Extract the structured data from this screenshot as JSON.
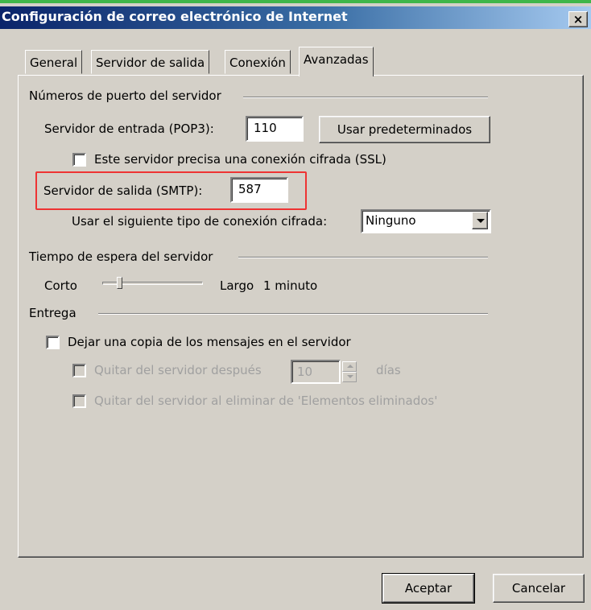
{
  "window": {
    "title": "Configuración de correo electrónico de Internet",
    "close_label": "×"
  },
  "tabs": [
    {
      "label": "General",
      "active": false
    },
    {
      "label": "Servidor de salida",
      "active": false
    },
    {
      "label": "Conexión",
      "active": false
    },
    {
      "label": "Avanzadas",
      "active": true
    }
  ],
  "ports": {
    "group_label": "Números de puerto del servidor",
    "incoming_label": "Servidor de entrada (POP3):",
    "incoming_value": "110",
    "defaults_button": "Usar predeterminados",
    "ssl_checkbox": {
      "label": "Este servidor precisa una conexión cifrada (SSL)",
      "checked": false
    },
    "outgoing_label": "Servidor de salida (SMTP):",
    "outgoing_value": "587",
    "encryption_label": "Usar el siguiente tipo de conexión cifrada:",
    "encryption_value": "Ninguno"
  },
  "timeout": {
    "group_label": "Tiempo de espera del servidor",
    "short_label": "Corto",
    "long_label": "Largo",
    "value_text": "1 minuto",
    "slider_level": 0.15
  },
  "delivery": {
    "group_label": "Entrega",
    "leave_copy": {
      "label": "Dejar una copia de los mensajes en el servidor",
      "checked": false
    },
    "remove_after": {
      "label": "Quitar del servidor después",
      "days_value": "10",
      "days_unit": "días",
      "checked": false,
      "enabled": false
    },
    "remove_deleted": {
      "label": "Quitar del servidor al eliminar de 'Elementos eliminados'",
      "checked": false,
      "enabled": false
    }
  },
  "footer": {
    "ok_label": "Aceptar",
    "cancel_label": "Cancelar"
  },
  "colors": {
    "title_bar": "#0a246a",
    "highlight_box": "#e33333",
    "dialog_face": "#d4d0c8"
  }
}
